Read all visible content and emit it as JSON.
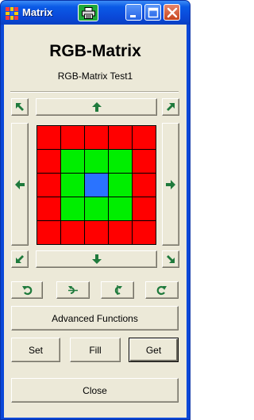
{
  "window": {
    "title": "Matrix",
    "colors": {
      "titlebar": "#0a48d8",
      "close": "#c6441c"
    }
  },
  "header": {
    "title": "RGB-Matrix",
    "subtitle": "RGB-Matrix Test1"
  },
  "matrix": {
    "rows": 5,
    "cols": 5,
    "cells": [
      [
        "#ff0000",
        "#ff0000",
        "#ff0000",
        "#ff0000",
        "#ff0000"
      ],
      [
        "#ff0000",
        "#00ee00",
        "#00ee00",
        "#00ee00",
        "#ff0000"
      ],
      [
        "#ff0000",
        "#00ee00",
        "#2a73ff",
        "#00ee00",
        "#ff0000"
      ],
      [
        "#ff0000",
        "#00ee00",
        "#00ee00",
        "#00ee00",
        "#ff0000"
      ],
      [
        "#ff0000",
        "#ff0000",
        "#ff0000",
        "#ff0000",
        "#ff0000"
      ]
    ]
  },
  "shift_buttons": {
    "icons": [
      "arrow-up-left-icon",
      "arrow-up-icon",
      "arrow-up-right-icon",
      "arrow-left-icon",
      "arrow-right-icon",
      "arrow-down-left-icon",
      "arrow-down-icon",
      "arrow-down-right-icon"
    ]
  },
  "transform_buttons": {
    "icons": [
      "rotate-left-icon",
      "flip-horizontal-icon",
      "flip-vertical-icon",
      "rotate-right-icon"
    ]
  },
  "actions": {
    "advanced_label": "Advanced Functions",
    "set_label": "Set",
    "fill_label": "Fill",
    "get_label": "Get",
    "close_label": "Close"
  },
  "icon_color": "#1f7a3c"
}
